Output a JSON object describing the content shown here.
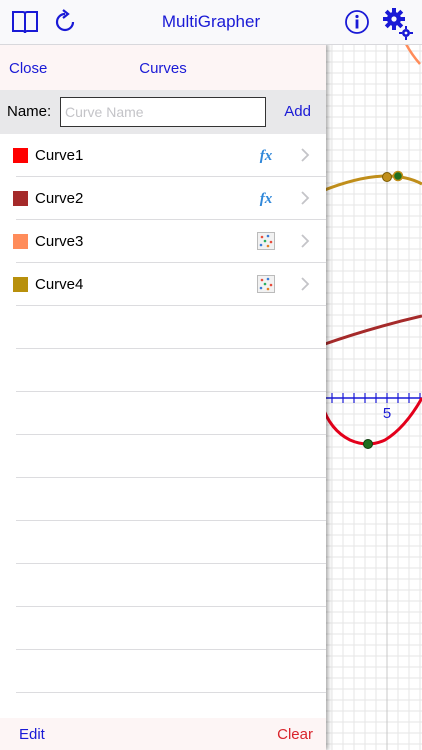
{
  "navbar": {
    "title": "MultiGrapher",
    "icons": [
      "book-icon",
      "refresh-icon",
      "info-icon",
      "settings-gears-icon"
    ],
    "accent_color": "#1a1ad6"
  },
  "panel": {
    "close_label": "Close",
    "title": "Curves",
    "name_label": "Name:",
    "name_value": "",
    "name_placeholder": "Curve Name",
    "add_label": "Add",
    "edit_label": "Edit",
    "clear_label": "Clear",
    "curves": [
      {
        "label": "Curve1",
        "color": "#ff0000",
        "type_icon": "function-fx-icon"
      },
      {
        "label": "Curve2",
        "color": "#a52a2a",
        "type_icon": "function-fx-icon"
      },
      {
        "label": "Curve3",
        "color": "#ff8c5a",
        "type_icon": "scatter-points-icon"
      },
      {
        "label": "Curve4",
        "color": "#b8900c",
        "type_icon": "scatter-points-icon"
      }
    ]
  },
  "graph": {
    "x_tick_label": "5",
    "curve_colors": [
      "#e3001b",
      "#a52a2a",
      "#ff8c5a",
      "#c08e1a"
    ],
    "point_color": "#1f6e1f"
  }
}
